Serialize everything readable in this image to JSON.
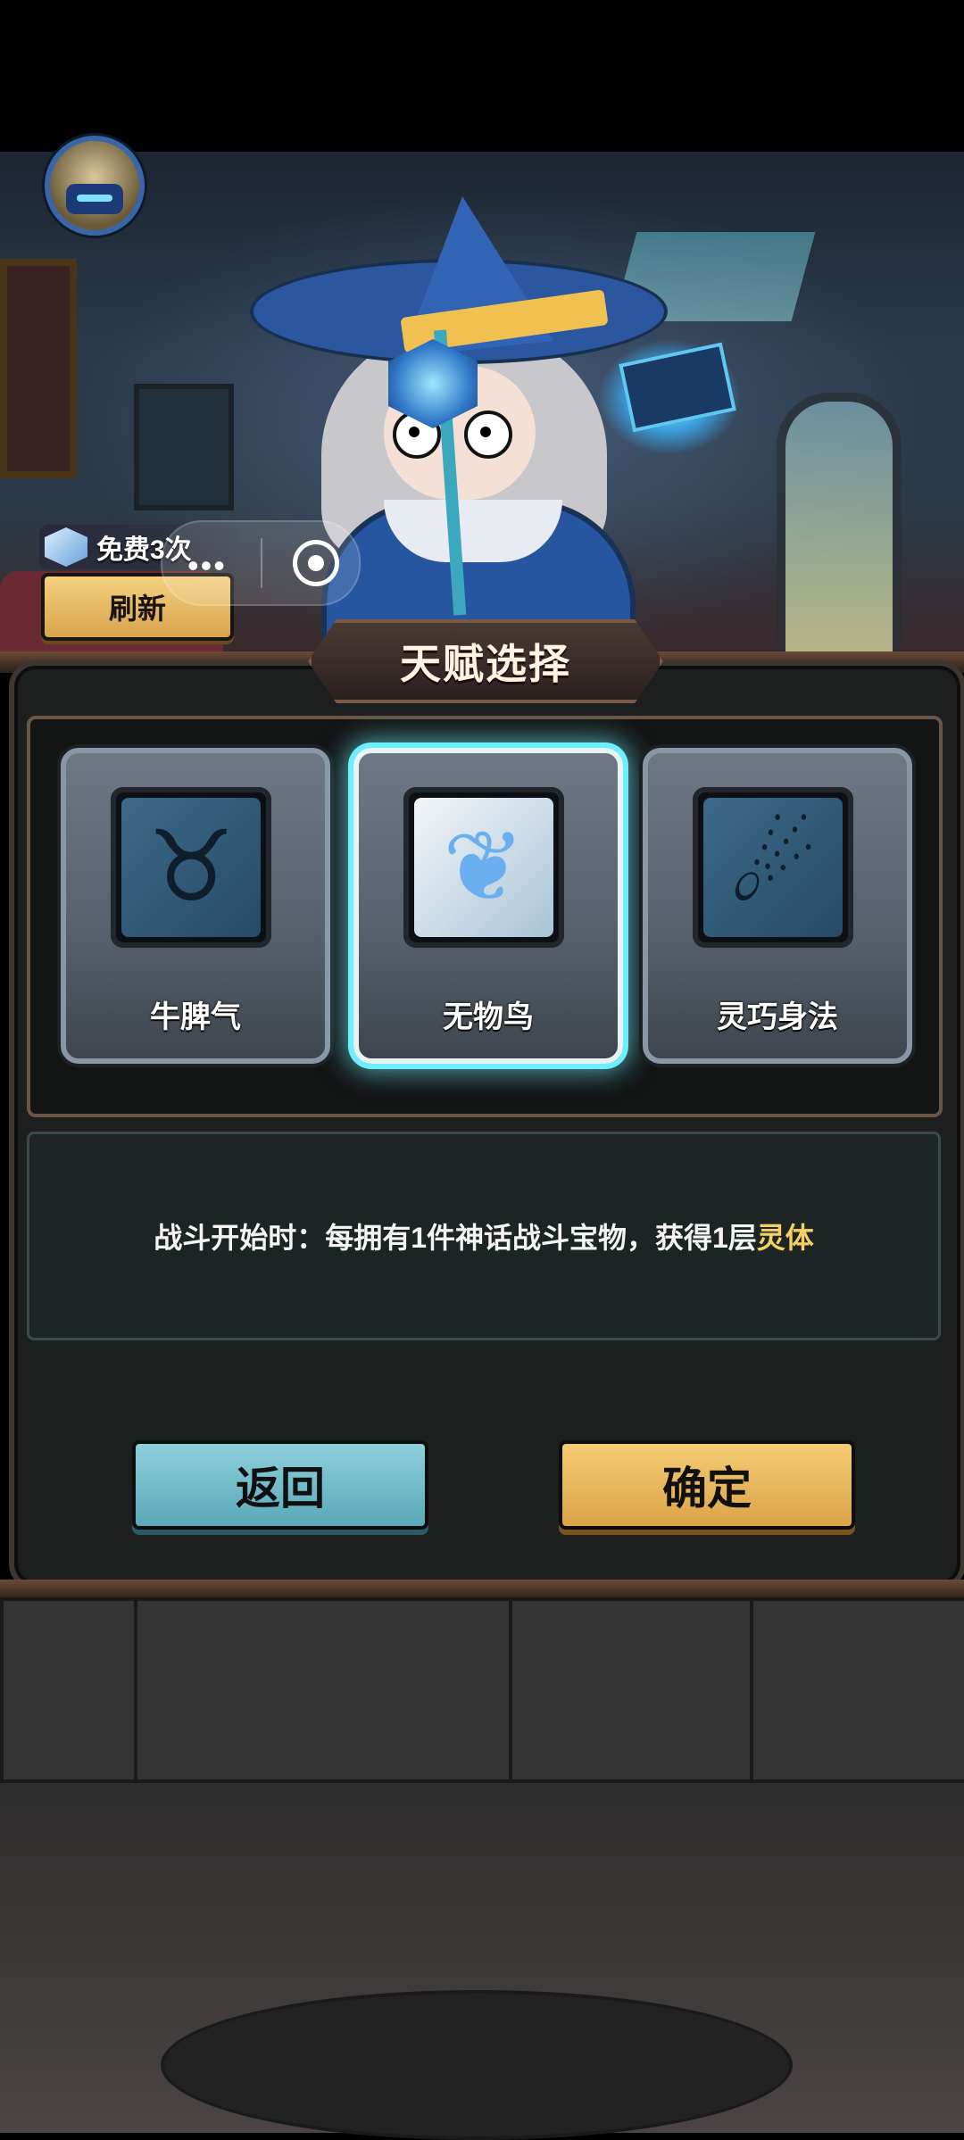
{
  "hud": {
    "avatar_icon": "knight-helmet-avatar-icon",
    "free_label": "免费3次",
    "refresh_label": "刷新"
  },
  "system_bar": {
    "more_icon": "•••",
    "record_icon": "target-record-icon"
  },
  "dialog": {
    "title": "天赋选择",
    "talents": [
      {
        "name": "牛脾气",
        "icon": "bull-head-icon",
        "selected": false
      },
      {
        "name": "无物鸟",
        "icon": "phoenix-bird-icon",
        "selected": true
      },
      {
        "name": "灵巧身法",
        "icon": "leaping-figure-icon",
        "selected": false
      }
    ],
    "description_prefix": "战斗开始时：每拥有1件神话战斗宝物，获得1层",
    "description_highlight": "灵体",
    "back_label": "返回",
    "confirm_label": "确定"
  },
  "colors": {
    "highlight_text": "#f4d060",
    "selected_glow": "#6cf0ff",
    "confirm_button": "#e8b860",
    "back_button": "#74bccc"
  }
}
